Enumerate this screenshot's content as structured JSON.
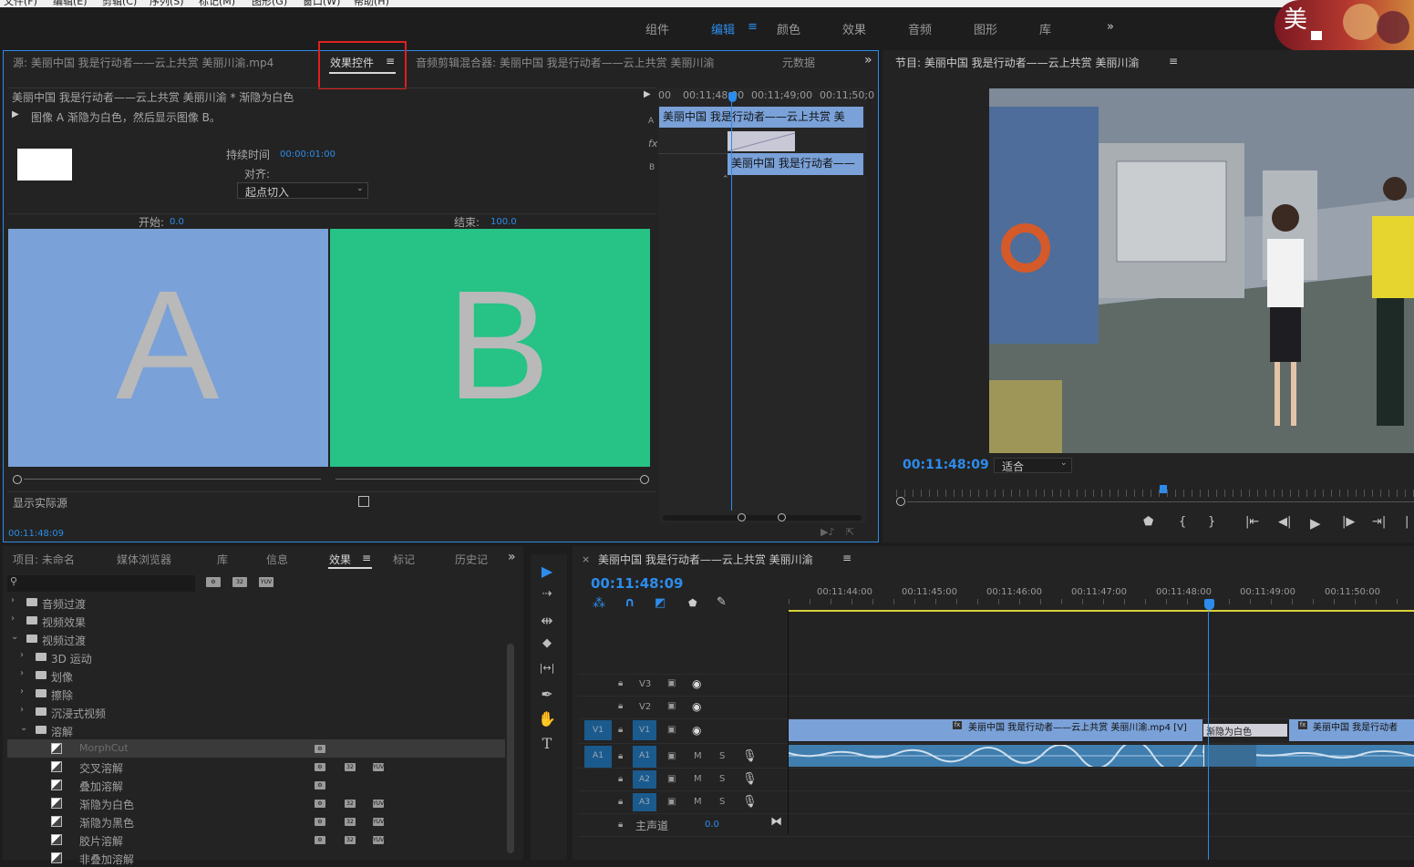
{
  "menubar": {
    "items": [
      "文件(F)",
      "编辑(E)",
      "剪辑(C)",
      "序列(S)",
      "标记(M)",
      "图形(G)",
      "窗口(W)",
      "帮助(H)"
    ]
  },
  "workspaces": {
    "tabs": [
      "组件",
      "编辑",
      "颜色",
      "效果",
      "音频",
      "图形",
      "库"
    ],
    "active_menu": "≡",
    "more": "»"
  },
  "source_panel": {
    "tabs": {
      "source": "源: 美丽中国 我是行动者——云上共赏 美丽川渝.mp4",
      "effect_controls": "效果控件",
      "effect_menu": "≡",
      "audio_mixer": "音频剪辑混合器: 美丽中国 我是行动者——云上共赏 美丽川渝",
      "metadata": "元数据",
      "more": "»"
    },
    "clip_path": "美丽中国 我是行动者——云上共赏 美丽川渝 * 渐隐为白色",
    "description": "图像 A 渐隐为白色，然后显示图像 B。",
    "duration_label": "持续时间",
    "duration_value": "00:00:01:00",
    "align_label": "对齐:",
    "align_value": "起点切入",
    "start_label": "开始:",
    "start_value": "0.0",
    "end_label": "结束:",
    "end_value": "100.0",
    "letter_a": "A",
    "letter_b": "B",
    "show_actual": "显示实际源",
    "timecode": "00:11:48:09",
    "mini_timeline": {
      "ticks": [
        "00",
        "00:11;48;00",
        "00:11;49;00",
        "00:11;50;0"
      ],
      "clip_top": "美丽中国 我是行动者——云上共赏 美",
      "clip_bottom": "美丽中国 我是行动者——",
      "track_a": "A",
      "track_fx": "fx",
      "track_b": "B"
    }
  },
  "program_panel": {
    "title": "节目: 美丽中国 我是行动者——云上共赏 美丽川渝",
    "menu": "≡",
    "timecode": "00:11:48:09",
    "fit": "适合"
  },
  "project_panel": {
    "tabs": [
      "项目: 未命名",
      "媒体浏览器",
      "库",
      "信息",
      "效果",
      "标记",
      "历史记"
    ],
    "effects_menu": "≡",
    "more": "»",
    "rows": [
      {
        "label": "音频过渡",
        "type": "folder",
        "indent": 0,
        "expanded": false
      },
      {
        "label": "视频效果",
        "type": "folder",
        "indent": 0,
        "expanded": false
      },
      {
        "label": "视频过渡",
        "type": "folder",
        "indent": 0,
        "expanded": true
      },
      {
        "label": "3D 运动",
        "type": "folder",
        "indent": 1,
        "expanded": false
      },
      {
        "label": "划像",
        "type": "folder",
        "indent": 1,
        "expanded": false
      },
      {
        "label": "擦除",
        "type": "folder",
        "indent": 1,
        "expanded": false
      },
      {
        "label": "沉浸式视频",
        "type": "folder",
        "indent": 1,
        "expanded": false
      },
      {
        "label": "溶解",
        "type": "folder",
        "indent": 1,
        "expanded": true
      },
      {
        "label": "MorphCut",
        "type": "effect",
        "indent": 2,
        "badges": 1,
        "selected": true
      },
      {
        "label": "交叉溶解",
        "type": "effect",
        "indent": 2,
        "badges": 3
      },
      {
        "label": "叠加溶解",
        "type": "effect",
        "indent": 2,
        "badges": 1
      },
      {
        "label": "渐隐为白色",
        "type": "effect",
        "indent": 2,
        "badges": 3
      },
      {
        "label": "渐隐为黑色",
        "type": "effect",
        "indent": 2,
        "badges": 3
      },
      {
        "label": "胶片溶解",
        "type": "effect",
        "indent": 2,
        "badges": 3
      },
      {
        "label": "非叠加溶解",
        "type": "effect",
        "indent": 2,
        "badges": 0
      }
    ]
  },
  "timeline": {
    "title": "美丽中国 我是行动者——云上共赏 美丽川渝",
    "menu": "≡",
    "close": "×",
    "timecode": "00:11:48:09",
    "ruler": [
      "00:11:44:00",
      "00:11:45:00",
      "00:11:46:00",
      "00:11:47:00",
      "00:11:48:00",
      "00:11:49:00",
      "00:11:50:00"
    ],
    "tracks": {
      "v3": "V3",
      "v2": "V2",
      "v1": "V1",
      "a1": "A1",
      "a2": "A2",
      "a3": "A3",
      "src_v1": "V1",
      "src_a1": "A1",
      "mute": "M",
      "solo": "S"
    },
    "master_label": "主声道",
    "master_value": "0.0",
    "clip_v1_a": "美丽中国 我是行动者——云上共赏 美丽川渝.mp4 [V]",
    "transition": "渐隐为白色",
    "clip_v1_b": "美丽中国 我是行动者"
  },
  "tools": [
    "▶",
    "⇢",
    "⇹",
    "◆",
    "|↔|",
    "✒",
    "✋",
    "T"
  ]
}
